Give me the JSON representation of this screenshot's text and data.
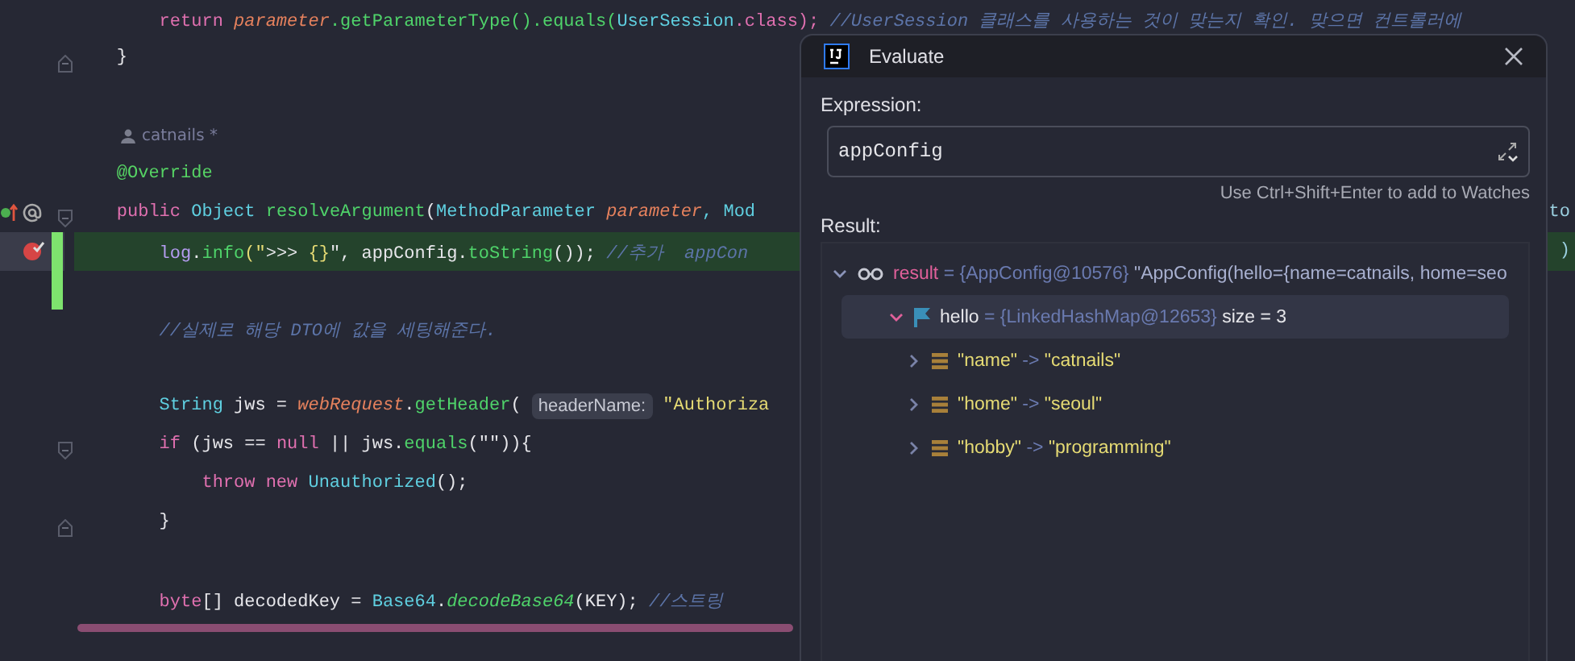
{
  "editor": {
    "lines": [
      {
        "kind": "code",
        "tokens": [
          {
            "text": "        return ",
            "kind": "kw"
          },
          {
            "text": "parameter",
            "kind": "param"
          },
          {
            "text": ".getParameterType().equals(",
            "kind": "fn"
          },
          {
            "text": "UserSession",
            "kind": "type"
          },
          {
            "text": ".class); ",
            "kind": "kw"
          },
          {
            "text": "//UserSession 클래스를 사용하는 것이 맞는지 확인. 맞으면 컨트롤러에",
            "kind": "comment"
          }
        ]
      },
      {
        "kind": "code",
        "fold_end": true,
        "tokens": [
          {
            "text": "    }",
            "kind": "plain"
          }
        ]
      },
      {
        "kind": "blank"
      },
      {
        "kind": "author",
        "author": "catnails *"
      },
      {
        "kind": "code",
        "tokens": [
          {
            "text": "    @Override",
            "kind": "annot"
          }
        ]
      },
      {
        "kind": "code",
        "fold_start": true,
        "overridden": true,
        "tokens": [
          {
            "text": "    public ",
            "kind": "kw"
          },
          {
            "text": "Object ",
            "kind": "type"
          },
          {
            "text": "resolveArgument",
            "kind": "fn"
          },
          {
            "text": "(",
            "kind": "plain"
          },
          {
            "text": "MethodParameter ",
            "kind": "type"
          },
          {
            "text": "parameter",
            "kind": "param"
          },
          {
            "text": ", Mod",
            "kind": "type"
          }
        ],
        "right": "to"
      },
      {
        "kind": "code",
        "breakpoint": true,
        "changed": true,
        "highlighted": true,
        "tokens": [
          {
            "text": "        log",
            "kind": "var"
          },
          {
            "text": ".",
            "kind": "plain"
          },
          {
            "text": "info",
            "kind": "fn"
          },
          {
            "text": "(\"",
            "kind": "str"
          },
          {
            "text": ">>> ",
            "kind": "plain"
          },
          {
            "text": "{}",
            "kind": "str"
          },
          {
            "text": "\", appConfig.",
            "kind": "plain"
          },
          {
            "text": "toString",
            "kind": "fn"
          },
          {
            "text": "()); ",
            "kind": "plain"
          },
          {
            "text": "//추가  appCon",
            "kind": "comment"
          }
        ],
        "right": ")"
      },
      {
        "kind": "blank",
        "changed": true
      },
      {
        "kind": "code",
        "tokens": [
          {
            "text": "        //실제로 해당 DTO에 값을 세팅해준다.",
            "kind": "comment"
          }
        ]
      },
      {
        "kind": "blank"
      },
      {
        "kind": "code",
        "tokens": [
          {
            "text": "        String ",
            "kind": "type"
          },
          {
            "text": "jws = ",
            "kind": "plain"
          },
          {
            "text": "webRequest",
            "kind": "param"
          },
          {
            "text": ".",
            "kind": "plain"
          },
          {
            "text": "getHeader",
            "kind": "fn"
          },
          {
            "text": "( ",
            "kind": "plain"
          },
          {
            "text": "headerName:",
            "kind": "hint"
          },
          {
            "text": " \"Authoriza",
            "kind": "str"
          }
        ]
      },
      {
        "kind": "code",
        "fold_start": true,
        "tokens": [
          {
            "text": "        if ",
            "kind": "kw"
          },
          {
            "text": "(jws == ",
            "kind": "plain"
          },
          {
            "text": "null ",
            "kind": "kw"
          },
          {
            "text": "|| jws.",
            "kind": "plain"
          },
          {
            "text": "equals",
            "kind": "fn"
          },
          {
            "text": "(\"\")){",
            "kind": "plain"
          }
        ]
      },
      {
        "kind": "code",
        "tokens": [
          {
            "text": "            throw new ",
            "kind": "kw"
          },
          {
            "text": "Unauthorized",
            "kind": "type"
          },
          {
            "text": "();",
            "kind": "plain"
          }
        ]
      },
      {
        "kind": "code",
        "fold_end": true,
        "tokens": [
          {
            "text": "        }",
            "kind": "plain"
          }
        ]
      },
      {
        "kind": "blank"
      },
      {
        "kind": "code",
        "tokens": [
          {
            "text": "        byte",
            "kind": "kw"
          },
          {
            "text": "[] decodedKey = ",
            "kind": "plain"
          },
          {
            "text": "Base64",
            "kind": "type"
          },
          {
            "text": ".",
            "kind": "plain"
          },
          {
            "text": "decodeBase64",
            "kind": "static"
          },
          {
            "text": "(KEY); ",
            "kind": "plain"
          },
          {
            "text": "//스트링",
            "kind": "comment"
          }
        ]
      }
    ]
  },
  "dialog": {
    "title": "Evaluate",
    "expression_label": "Expression:",
    "expression": "appConfig",
    "hint": "Use Ctrl+Shift+Enter to add to Watches",
    "result_label": "Result:",
    "tree": [
      {
        "kind": "watch",
        "name": "result",
        "info": "= {AppConfig@10576}",
        "value": "\"AppConfig(hello={name=catnails, home=seo",
        "expanded": true,
        "selected": false,
        "children": [
          {
            "kind": "field",
            "name": "hello",
            "info": "= {LinkedHashMap@12653}",
            "value": "size = 3",
            "expanded": true,
            "selected": true,
            "children": [
              {
                "kind": "entry",
                "name": "\"name\"",
                "info": "->",
                "value": "\"catnails\"",
                "expanded": false,
                "selected": false
              },
              {
                "kind": "entry",
                "name": "\"home\"",
                "info": "->",
                "value": "\"seoul\"",
                "expanded": false,
                "selected": false
              },
              {
                "kind": "entry",
                "name": "\"hobby\"",
                "info": "->",
                "value": "\"programming\"",
                "expanded": false,
                "selected": false
              }
            ]
          }
        ]
      }
    ]
  }
}
